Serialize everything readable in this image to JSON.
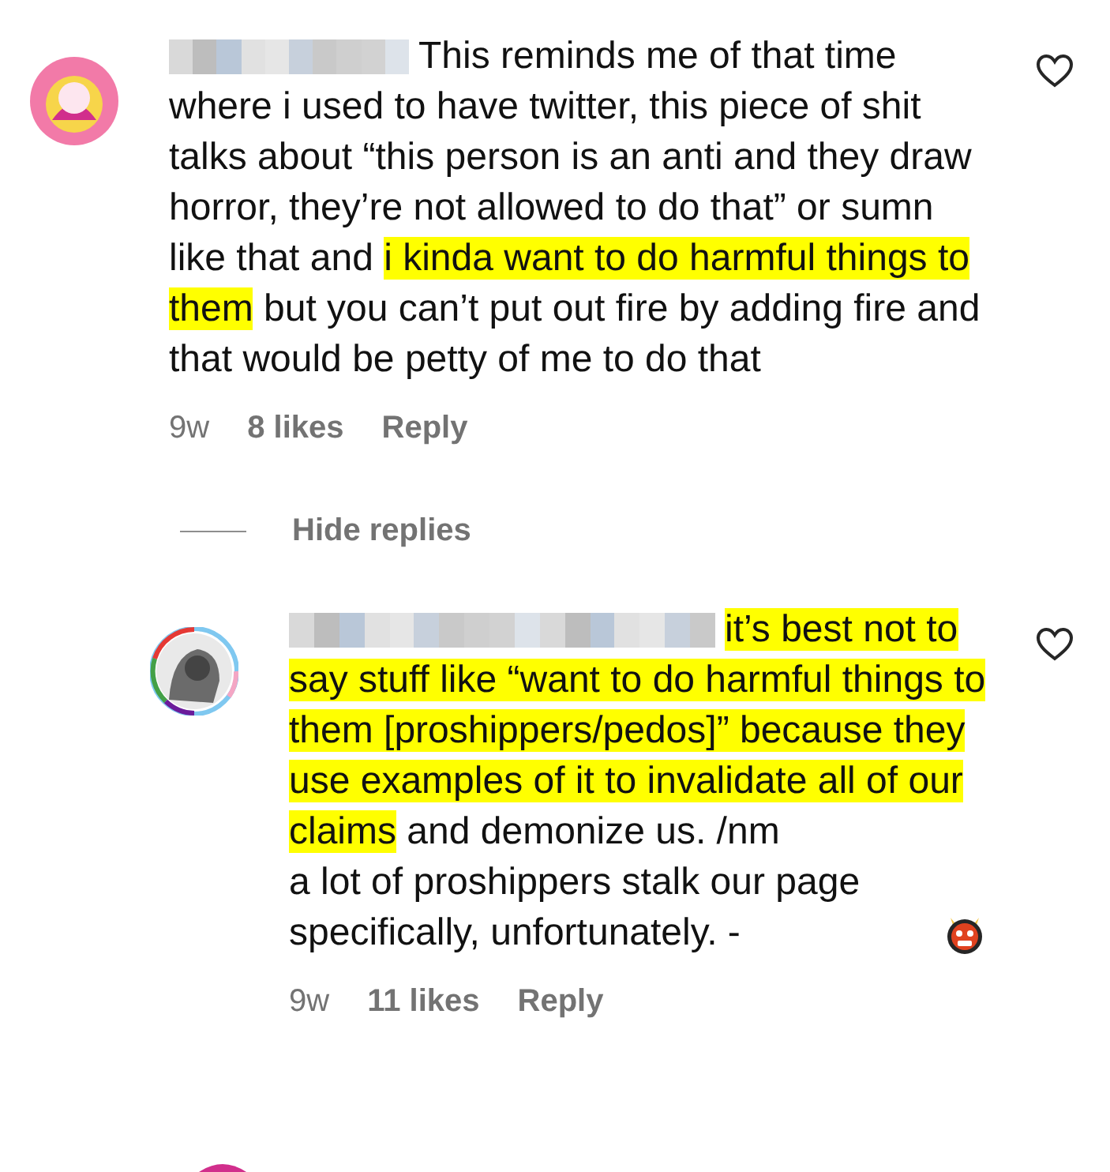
{
  "comments": [
    {
      "paragraphs": [
        [
          {
            "text": "This reminds me of that time where i used to have twitter, this piece of shit talks about “this person is an anti and they draw horror, they’re not allowed to do that” or sumn like that and ",
            "highlighted": false
          },
          {
            "text": "i kinda want to do harmful things to them",
            "highlighted": true
          },
          {
            "text": " but you can’t put out fire by adding fire and that would be petty of me to do that",
            "highlighted": false
          }
        ]
      ],
      "liked": false,
      "time": "9w",
      "likes": "8 likes",
      "reply": "Reply"
    }
  ],
  "hide_replies": "Hide replies",
  "replies": [
    {
      "paragraphs": [
        [
          {
            "text": "it’s best not to say stuff like “want to do harmful things to them [proshippers/pedos]” because they use examples of it to invalidate all of our claims",
            "highlighted": true
          },
          {
            "text": " and demonize us. /nm",
            "highlighted": false
          }
        ],
        [
          {
            "text": "a lot of proshippers stalk our page specifically, unfortunately. -",
            "highlighted": false
          }
        ]
      ],
      "liked": false,
      "time": "9w",
      "likes": "11 likes",
      "reply": "Reply"
    }
  ]
}
